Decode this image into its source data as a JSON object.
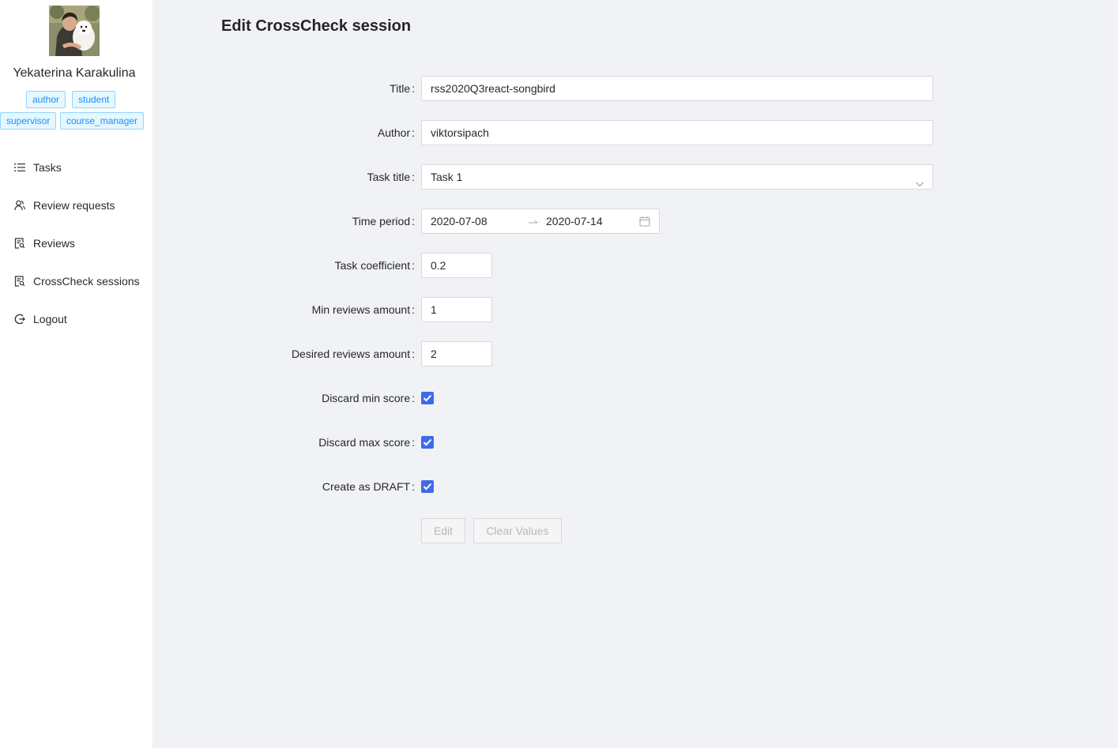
{
  "user": {
    "name": "Yekaterina Karakulina",
    "roles": [
      "author",
      "student",
      "supervisor",
      "course_manager"
    ]
  },
  "menu": {
    "items": [
      {
        "label": "Tasks",
        "icon": "list-icon"
      },
      {
        "label": "Review requests",
        "icon": "users-icon"
      },
      {
        "label": "Reviews",
        "icon": "file-search-icon"
      },
      {
        "label": "CrossCheck sessions",
        "icon": "file-search-icon"
      },
      {
        "label": "Logout",
        "icon": "logout-icon"
      }
    ]
  },
  "page": {
    "title": "Edit CrossCheck session"
  },
  "form": {
    "title": {
      "label": "Title",
      "value": "rss2020Q3react-songbird"
    },
    "author": {
      "label": "Author",
      "value": "viktorsipach"
    },
    "task_title": {
      "label": "Task title",
      "value": "Task 1"
    },
    "time_period": {
      "label": "Time period",
      "start": "2020-07-08",
      "end": "2020-07-14"
    },
    "task_coefficient": {
      "label": "Task coefficient",
      "value": "0.2"
    },
    "min_reviews": {
      "label": "Min reviews amount",
      "value": "1"
    },
    "desired_reviews": {
      "label": "Desired reviews amount",
      "value": "2"
    },
    "discard_min": {
      "label": "Discard min score",
      "checked": true
    },
    "discard_max": {
      "label": "Discard max score",
      "checked": true
    },
    "draft": {
      "label": "Create as DRAFT",
      "checked": true
    },
    "colon": ":",
    "buttons": {
      "edit": "Edit",
      "clear": "Clear Values"
    }
  },
  "colors": {
    "checkbox": "#3f6ae8",
    "tag_text": "#1890ff",
    "tag_bg": "#e6f7ff",
    "tag_border": "#91d5ff",
    "background": "#f0f2f5"
  }
}
